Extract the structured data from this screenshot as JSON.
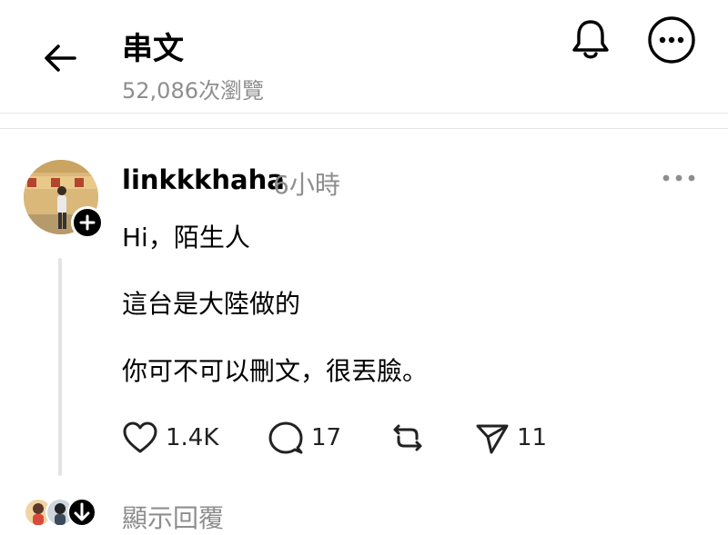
{
  "header": {
    "title": "串文",
    "views": "52,086次瀏覽",
    "icons": {
      "back": "arrow-left-icon",
      "bell": "bell-icon",
      "more": "more-horizontal-circle-icon"
    }
  },
  "post": {
    "username": "linkkkhaha",
    "time": "6小時",
    "lines": [
      "Hi，陌生人",
      "這台是大陸做的",
      "你可不可以刪文，很丟臉。"
    ],
    "actions": {
      "likes": "1.4K",
      "comments": "17",
      "shares": "11"
    }
  },
  "footer": {
    "show_replies": "顯示回覆"
  },
  "colors": {
    "muted": "#8e8e8e",
    "divider": "#e5e5e5",
    "thread_line": "#e3e3e3"
  }
}
